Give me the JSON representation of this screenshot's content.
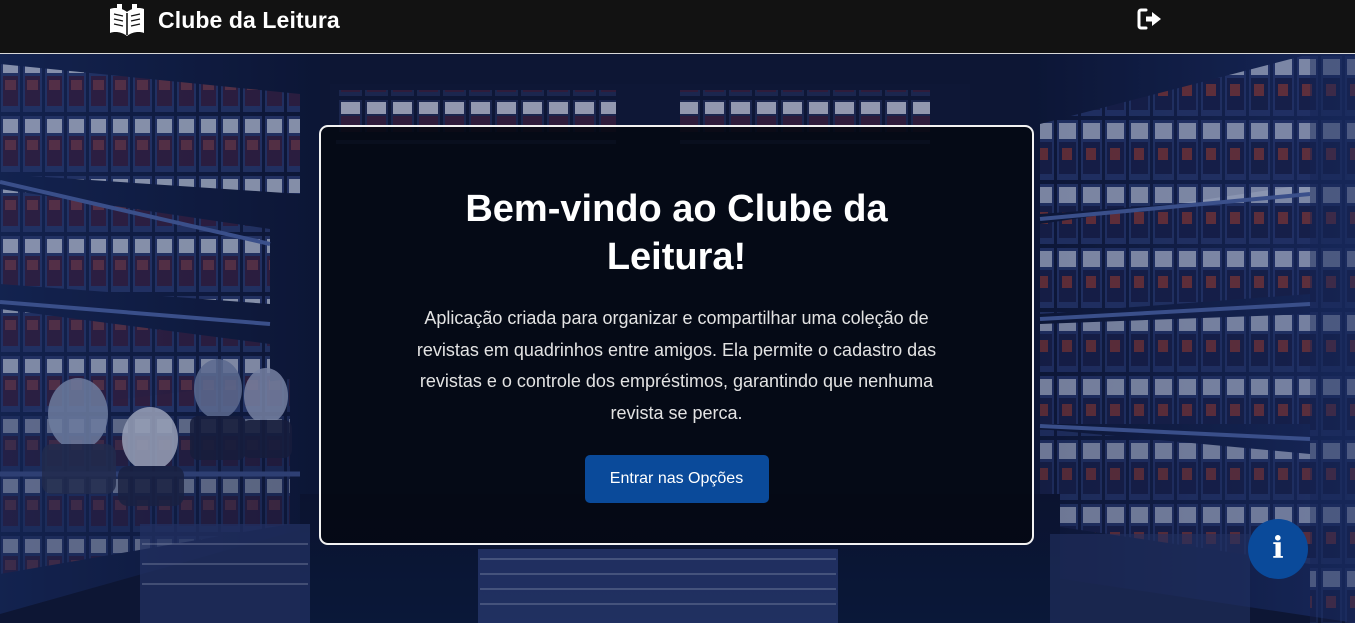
{
  "navbar": {
    "brand": "Clube da Leitura",
    "brand_icon": "book-open-icon",
    "logout_icon": "sign-out-icon"
  },
  "hero": {
    "title": "Bem-vindo ao Clube da Leitura!",
    "description": "Aplicação criada para organizar e compartilhar uma coleção de revistas em quadrinhos entre amigos. Ela permite o cadastro das revistas e o controle dos empréstimos, garantindo que nenhuma revista se perca.",
    "cta_label": "Entrar nas Opções",
    "background": "comic-store-shelves-image"
  },
  "info_button": {
    "label": "i",
    "icon": "info-icon"
  },
  "colors": {
    "navbar_bg": "#121212",
    "primary": "#0a4a9a",
    "card_bg": "#040710",
    "text": "#ffffff"
  }
}
